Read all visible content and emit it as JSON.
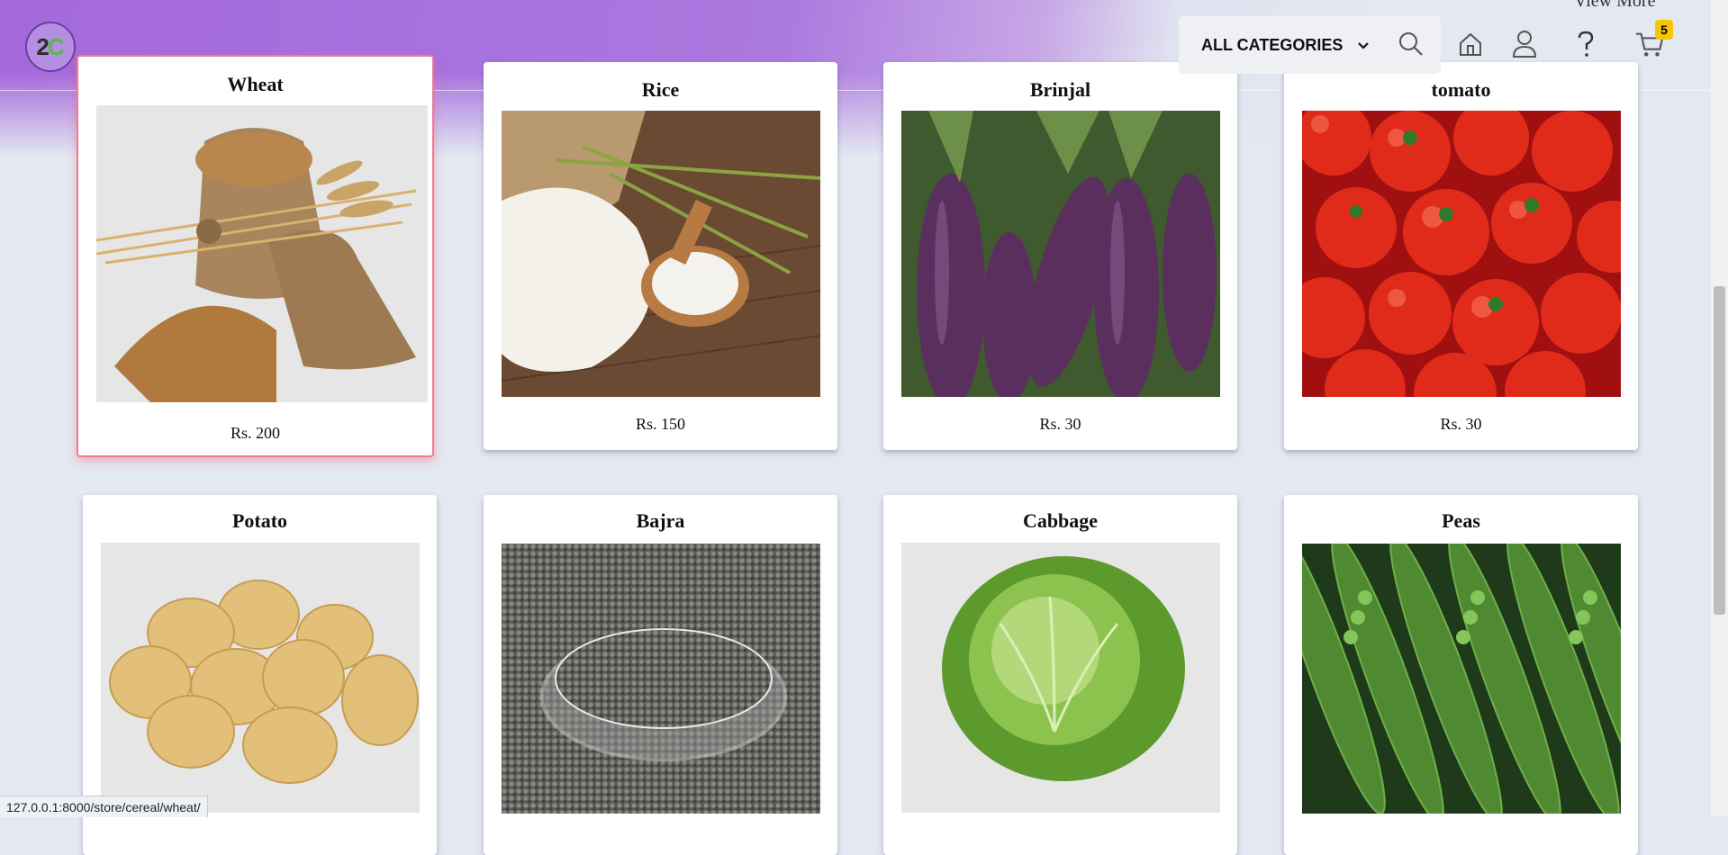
{
  "header": {
    "logo_text": "2",
    "logo_accent": "C",
    "view_more": "View More",
    "category_label": "ALL CATEGORIES",
    "cart_count": "5"
  },
  "products": [
    {
      "name": "Wheat",
      "price": "Rs. 200"
    },
    {
      "name": "Rice",
      "price": "Rs. 150"
    },
    {
      "name": "Brinjal",
      "price": "Rs. 30"
    },
    {
      "name": "tomato",
      "price": "Rs. 30"
    },
    {
      "name": "Potato"
    },
    {
      "name": "Bajra"
    },
    {
      "name": "Cabbage"
    },
    {
      "name": "Peas"
    }
  ],
  "status": {
    "url": "127.0.0.1:8000/store/cereal/wheat/"
  },
  "colors": {
    "accent_purple": "#a468db",
    "badge_yellow": "#f7c600",
    "active_border": "#f07a90"
  }
}
